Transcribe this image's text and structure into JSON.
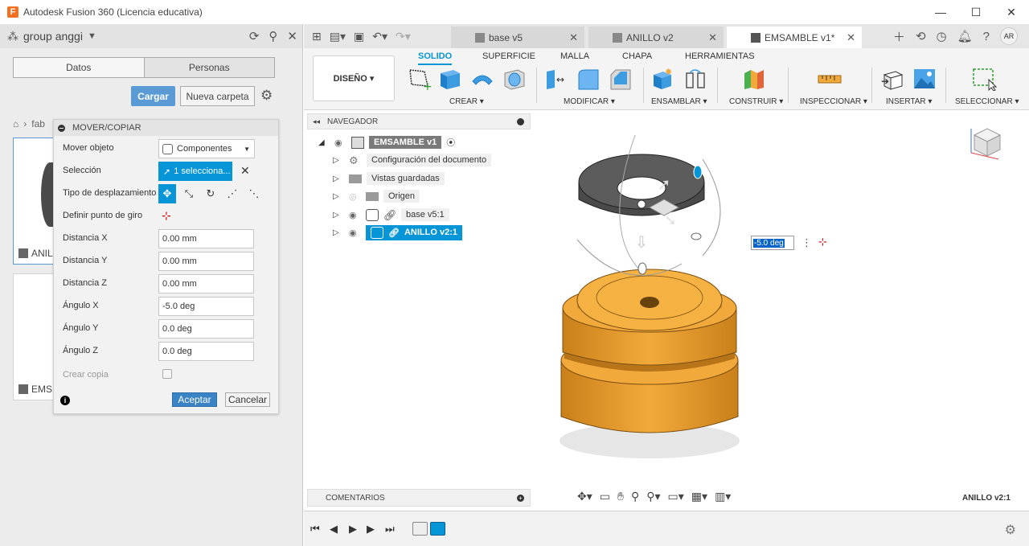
{
  "window": {
    "title": "Autodesk Fusion 360 (Licencia educativa)",
    "logo_letter": "F",
    "minimize": "—",
    "maximize": "☐",
    "close": "✕"
  },
  "data_panel": {
    "group_name": "group anggi",
    "tabs": [
      "Datos",
      "Personas"
    ],
    "load_button": "Cargar",
    "new_folder_button": "Nueva carpeta",
    "breadcrumb_text": "fab",
    "cards": [
      {
        "label": "ANIL"
      },
      {
        "label": "EMS"
      }
    ]
  },
  "dialog": {
    "title": "MOVER/COPIAR",
    "mover_objeto_label": "Mover objeto",
    "mover_objeto_value": "Componentes",
    "seleccion_label": "Selección",
    "seleccion_value": "1 selecciona...",
    "tipo_label": "Tipo de desplazamiento",
    "punto_giro_label": "Definir punto de giro",
    "fields": [
      {
        "label": "Distancia X",
        "value": "0.00 mm"
      },
      {
        "label": "Distancia Y",
        "value": "0.00 mm"
      },
      {
        "label": "Distancia Z",
        "value": "0.00 mm"
      },
      {
        "label": "Ángulo X",
        "value": "-5.0 deg"
      },
      {
        "label": "Ángulo Y",
        "value": "0.0 deg"
      },
      {
        "label": "Ángulo Z",
        "value": "0.0 deg"
      }
    ],
    "crear_copia_label": "Crear copia",
    "accept_button": "Aceptar",
    "cancel_button": "Cancelar"
  },
  "doc_tabs": [
    {
      "label": "base v5",
      "active": false
    },
    {
      "label": "ANILLO v2",
      "active": false
    },
    {
      "label": "EMSAMBLE v1*",
      "active": true
    }
  ],
  "avatar_initials": "AR",
  "ribbon": {
    "workspace": "DISEÑO ▾",
    "tabs": [
      "SOLIDO",
      "SUPERFICIE",
      "MALLA",
      "CHAPA",
      "HERRAMIENTAS"
    ],
    "groups": [
      "CREAR ▾",
      "MODIFICAR ▾",
      "ENSAMBLAR ▾",
      "CONSTRUIR ▾",
      "INSPECCIONAR ▾",
      "INSERTAR ▾",
      "SELECCIONAR ▾"
    ]
  },
  "browser": {
    "title": "NAVEGADOR",
    "items": [
      {
        "label": "EMSAMBLE v1"
      },
      {
        "label": "Configuración del documento"
      },
      {
        "label": "Vistas guardadas"
      },
      {
        "label": "Origen"
      },
      {
        "label": "base v5:1"
      },
      {
        "label": "ANILLO v2:1"
      }
    ],
    "comments": "COMENTARIOS"
  },
  "viewport": {
    "angle_input": "-5.0 deg",
    "active_component": "ANILLO v2:1"
  },
  "colors": {
    "accent": "#0696d7",
    "base_part": "#f2a93b",
    "ring_part": "#5c5c5c"
  }
}
